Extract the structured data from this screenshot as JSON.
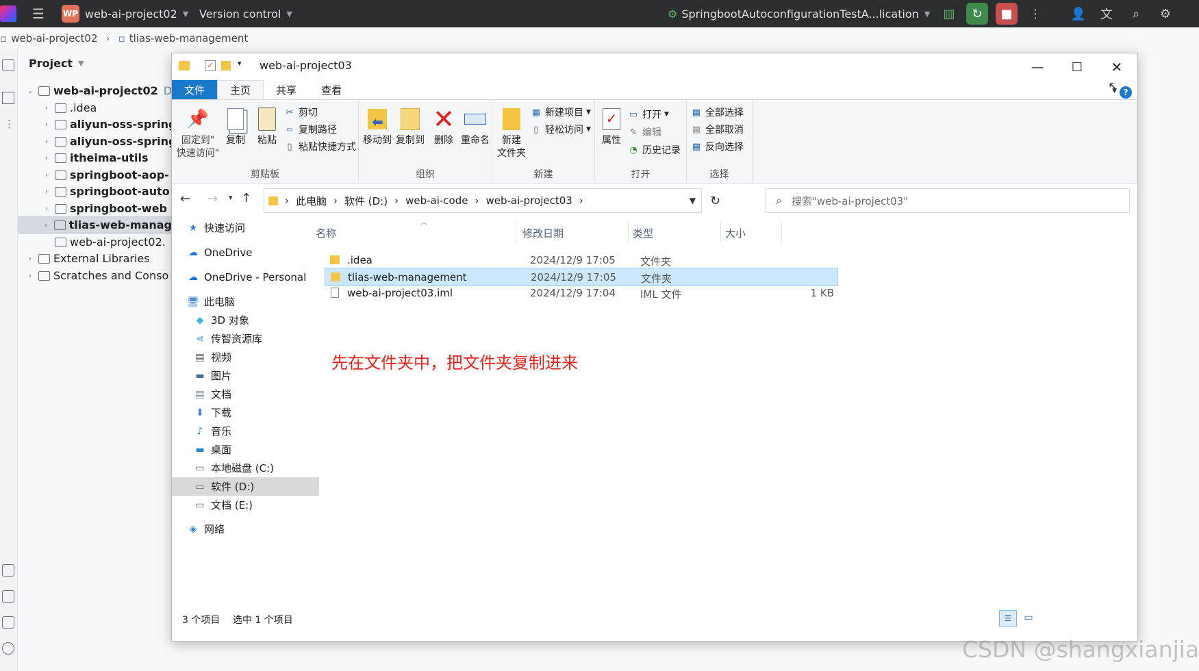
{
  "ide": {
    "project_badge": "WP",
    "project_name": "web-ai-project02",
    "version_control": "Version control",
    "run_config": "SpringbootAutoconfigurationTestA...lication",
    "breadcrumb": [
      "web-ai-project02",
      "tlias-web-management"
    ],
    "project_panel_title": "Project",
    "tree": [
      {
        "label": "web-ai-project02",
        "suffix": "D",
        "bold": true,
        "expanded": true
      },
      {
        "label": ".idea"
      },
      {
        "label": "aliyun-oss-spring",
        "bold": true
      },
      {
        "label": "aliyun-oss-spring",
        "bold": true
      },
      {
        "label": "itheima-utils",
        "bold": true
      },
      {
        "label": "springboot-aop-",
        "bold": true
      },
      {
        "label": "springboot-auto",
        "bold": true
      },
      {
        "label": "springboot-web",
        "bold": true
      },
      {
        "label": "tlias-web-manag",
        "bold": true,
        "selected": true
      },
      {
        "label": "web-ai-project02."
      },
      {
        "label": "External Libraries"
      },
      {
        "label": "Scratches and Conso"
      }
    ]
  },
  "explorer": {
    "title": "web-ai-project03",
    "tabs": [
      "文件",
      "主页",
      "共享",
      "查看"
    ],
    "ribbon": {
      "clipboard": {
        "label": "剪贴板",
        "pin": "固定到\"\n快速访问\"",
        "copy": "复制",
        "paste": "粘贴",
        "cut": "剪切",
        "copy_path": "复制路径",
        "paste_shortcut": "粘贴快捷方式"
      },
      "organize": {
        "label": "组织",
        "move_to": "移动到",
        "copy_to": "复制到",
        "delete": "删除",
        "rename": "重命名"
      },
      "new": {
        "label": "新建",
        "new_folder": "新建\n文件夹",
        "new_item": "新建项目",
        "easy_access": "轻松访问"
      },
      "open": {
        "label": "打开",
        "properties": "属性",
        "open": "打开",
        "edit": "编辑",
        "history": "历史记录"
      },
      "select": {
        "label": "选择",
        "select_all": "全部选择",
        "select_none": "全部取消",
        "invert": "反向选择"
      }
    },
    "address": [
      "此电脑",
      "软件 (D:)",
      "web-ai-code",
      "web-ai-project03"
    ],
    "search_placeholder": "搜索\"web-ai-project03\"",
    "nav": [
      {
        "label": "快速访问",
        "icon": "star-icon"
      },
      {
        "label": "OneDrive",
        "icon": "cloud-icon"
      },
      {
        "label": "OneDrive - Personal",
        "icon": "cloud-icon"
      },
      {
        "label": "此电脑",
        "icon": "computer-icon"
      },
      {
        "label": "3D 对象",
        "icon": "cube-icon"
      },
      {
        "label": "传智资源库",
        "icon": "share-icon"
      },
      {
        "label": "视频",
        "icon": "video-icon"
      },
      {
        "label": "图片",
        "icon": "picture-icon"
      },
      {
        "label": "文档",
        "icon": "document-icon"
      },
      {
        "label": "下载",
        "icon": "download-icon"
      },
      {
        "label": "音乐",
        "icon": "music-icon"
      },
      {
        "label": "桌面",
        "icon": "desktop-icon"
      },
      {
        "label": "本地磁盘 (C:)",
        "icon": "drive-icon"
      },
      {
        "label": "软件 (D:)",
        "icon": "drive-icon",
        "selected": true
      },
      {
        "label": "文档 (E:)",
        "icon": "drive-icon"
      },
      {
        "label": "网络",
        "icon": "network-icon"
      }
    ],
    "columns": [
      "名称",
      "修改日期",
      "类型",
      "大小"
    ],
    "files": [
      {
        "name": ".idea",
        "date": "2024/12/9 17:05",
        "type": "文件夹",
        "size": "",
        "kind": "folder"
      },
      {
        "name": "tlias-web-management",
        "date": "2024/12/9 17:05",
        "type": "文件夹",
        "size": "",
        "kind": "folder",
        "selected": true
      },
      {
        "name": "web-ai-project03.iml",
        "date": "2024/12/9 17:04",
        "type": "IML 文件",
        "size": "1 KB",
        "kind": "file"
      }
    ],
    "annotation": "先在文件夹中，把文件夹复制进来",
    "status_count": "3 个项目",
    "status_selected": "选中 1 个项目"
  },
  "watermark": "CSDN @shangxianjiao"
}
